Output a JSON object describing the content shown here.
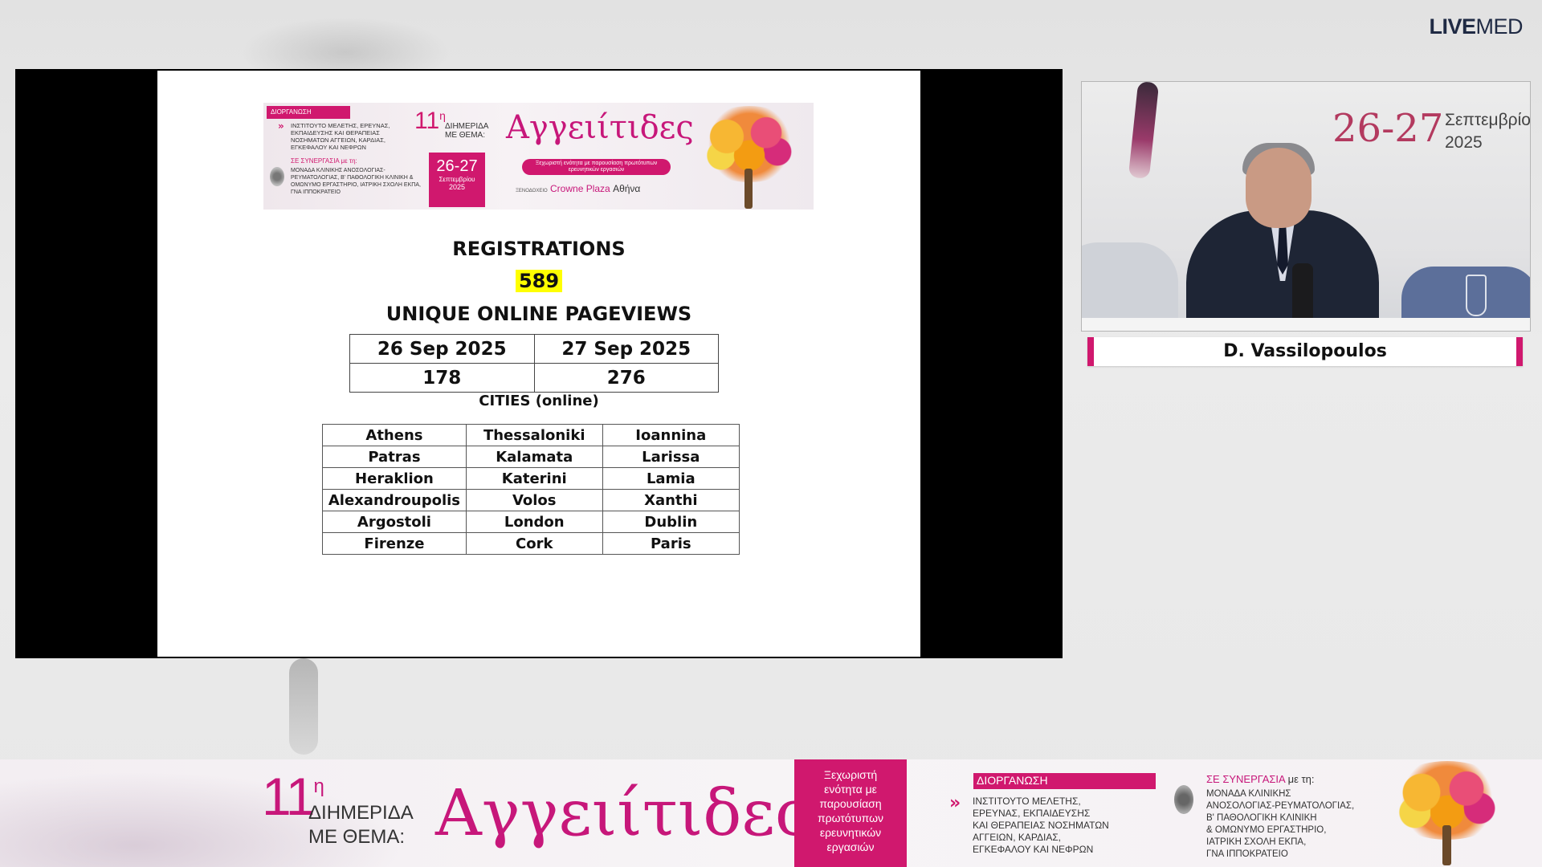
{
  "brand": {
    "bold": "LIVE",
    "light": "MED"
  },
  "slide": {
    "banner": {
      "org_tag": "ΔΙΟΡΓΑΝΩΣΗ",
      "org_text": "ΙΝΣΤΙΤΟΥΤΟ ΜΕΛΕΤΗΣ, ΕΡΕΥΝΑΣ, ΕΚΠΑΙΔΕΥΣΗΣ ΚΑΙ ΘΕΡΑΠΕΙΑΣ ΝΟΣΗΜΑΤΩΝ ΑΓΓΕΙΩΝ, ΚΑΡΔΙΑΣ, ΕΓΚΕΦΑΛΟΥ ΚΑΙ ΝΕΦΡΩΝ",
      "collab_label": "ΣΕ ΣΥΝΕΡΓΑΣΙΑ με τη:",
      "collab_text": "ΜΟΝΑΔΑ ΚΛΙΝΙΚΗΣ ΑΝΟΣΟΛΟΓΙΑΣ-ΡΕΥΜΑΤΟΛΟΓΙΑΣ, Β' ΠΑΘΟΛΟΓΙΚΗ ΚΛΙΝΙΚΗ & ΟΜΩΝΥΜΟ ΕΡΓΑΣΤΗΡΙΟ, ΙΑΤΡΙΚΗ ΣΧΟΛΗ ΕΚΠΑ, ΓΝΑ ΙΠΠΟΚΡΑΤΕΙΟ",
      "edition_num": "11",
      "edition_sup": "η",
      "edition_text": "ΔΙΗΜΕΡΙΔΑ ΜΕ ΘΕΜΑ:",
      "title": "Αγγειίτιδες",
      "date_days": "26-27",
      "date_month": "Σεπτεμβρίου",
      "date_year": "2025",
      "pill_text": "Ξεχωριστή ενότητα με παρουσίαση πρωτότυπων ερευνητικών εργασιών",
      "venue_prefix": "ΞΕΝΟΔΟΧΕΙΟ",
      "venue": "Crowne Plaza",
      "city": "Αθήνα"
    },
    "registrations_label": "REGISTRATIONS",
    "registrations_value": "589",
    "pageviews_label": "UNIQUE ONLINE PAGEVIEWS",
    "pageviews": {
      "headers": [
        "26 Sep 2025",
        "27 Sep 2025"
      ],
      "values": [
        "178",
        "276"
      ]
    },
    "cities_label": "CITIES (online)",
    "cities": [
      [
        "Athens",
        "Thessaloniki",
        "Ioannina"
      ],
      [
        "Patras",
        "Kalamata",
        "Larissa"
      ],
      [
        "Heraklion",
        "Katerini",
        "Lamia"
      ],
      [
        "Alexandroupolis",
        "Volos",
        "Xanthi"
      ],
      [
        "Argostoli",
        "London",
        "Dublin"
      ],
      [
        "Firenze",
        "Cork",
        "Paris"
      ]
    ]
  },
  "video": {
    "backdrop_dates": "26-27",
    "backdrop_month": "Σεπτεμβρίου",
    "backdrop_year": "2025"
  },
  "speaker": {
    "name": "D. Vassilopoulos"
  },
  "bottom_banner": {
    "edition_num": "11",
    "edition_sup": "η",
    "edition_line1": "ΔΙΗΜΕΡΙΔΑ",
    "edition_line2": "ΜΕ ΘΕΜΑ:",
    "title": "Αγγειίτιδες",
    "pink_box_lines": [
      "Ξεχωριστή",
      "ενότητα με",
      "παρουσίαση",
      "πρωτότυπων",
      "ερευνητικών",
      "εργασιών"
    ],
    "org_tag": "ΔΙΟΡΓΑΝΩΣΗ",
    "org_lines": [
      "ΙΝΣΤΙΤΟΥΤΟ ΜΕΛΕΤΗΣ,",
      "ΕΡΕΥΝΑΣ, ΕΚΠΑΙΔΕΥΣΗΣ",
      "ΚΑΙ ΘΕΡΑΠΕΙΑΣ ΝΟΣΗΜΑΤΩΝ",
      "ΑΓΓΕΙΩΝ, ΚΑΡΔΙΑΣ,",
      "ΕΓΚΕΦΑΛΟΥ ΚΑΙ ΝΕΦΡΩΝ"
    ],
    "collab_label_strong": "ΣΕ ΣΥΝΕΡΓΑΣΙΑ",
    "collab_label_rest": " με τη:",
    "collab_lines": [
      "ΜΟΝΑΔΑ ΚΛΙΝΙΚΗΣ",
      "ΑΝΟΣΟΛΟΓΙΑΣ-ΡΕΥΜΑΤΟΛΟΓΙΑΣ,",
      "Β' ΠΑΘΟΛΟΓΙΚΗ ΚΛΙΝΙΚΗ",
      "& ΟΜΩΝΥΜΟ ΕΡΓΑΣΤΗΡΙΟ,",
      "ΙΑΤΡΙΚΗ ΣΧΟΛΗ ΕΚΠΑ,",
      "ΓΝΑ ΙΠΠΟΚΡΑΤΕΙΟ"
    ]
  },
  "colors": {
    "accent": "#d0186e",
    "highlight": "#ffff00",
    "brand_navy": "#1f2a44"
  },
  "icons": [
    "tree-logo-icon",
    "seal-icon",
    "chevron-right-icon"
  ]
}
